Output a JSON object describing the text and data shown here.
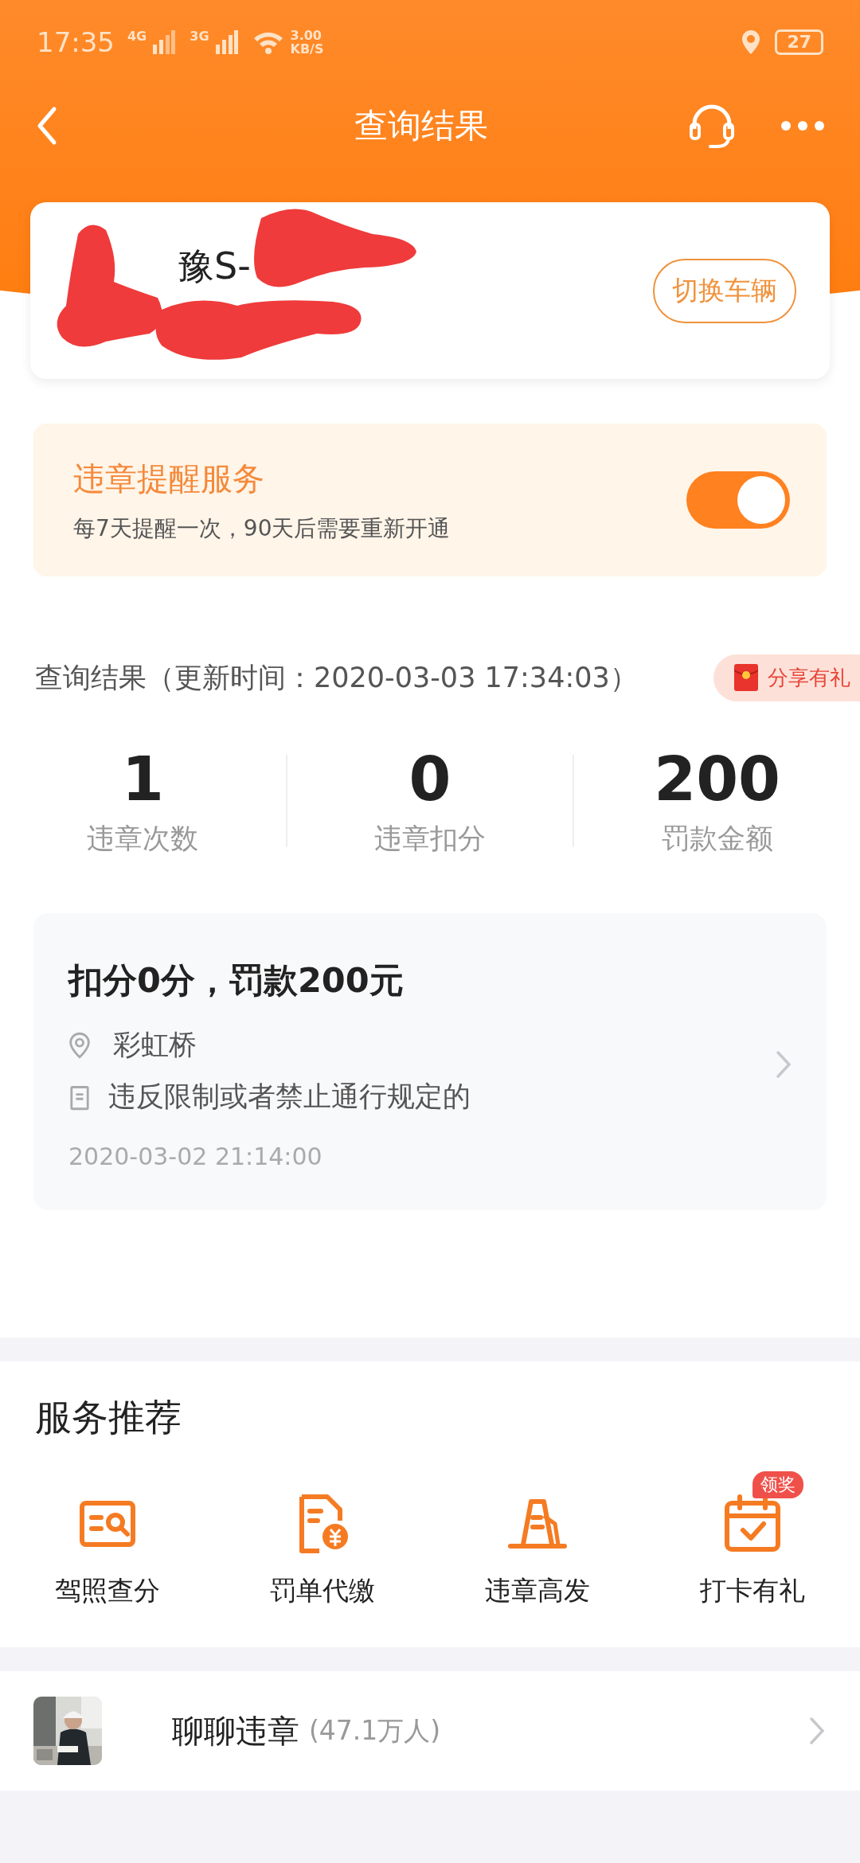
{
  "status_bar": {
    "time": "17:35",
    "net_1": "4G",
    "net_2": "3G",
    "speed": "3.00",
    "speed_unit": "KB/S",
    "battery": "27"
  },
  "header": {
    "title": "查询结果"
  },
  "vehicle": {
    "plate": "豫S-",
    "switch_button": "切换车辆"
  },
  "reminder": {
    "title": "违章提醒服务",
    "subtitle": "每7天提醒一次，90天后需要重新开通",
    "on": true
  },
  "result": {
    "heading": "查询结果（更新时间：2020-03-03 17:34:03）",
    "share_badge": "分享有礼"
  },
  "stats": [
    {
      "value": "1",
      "label": "违章次数"
    },
    {
      "value": "0",
      "label": "违章扣分"
    },
    {
      "value": "200",
      "label": "罚款金额"
    }
  ],
  "violations": [
    {
      "title": "扣分0分，罚款200元",
      "location": "彩虹桥",
      "reason": "违反限制或者禁止通行规定的",
      "time": "2020-03-02 21:14:00"
    }
  ],
  "services": {
    "title": "服务推荐",
    "items": [
      {
        "kind": "license",
        "label": "驾照查分"
      },
      {
        "kind": "fine",
        "label": "罚单代缴"
      },
      {
        "kind": "cone",
        "label": "违章高发"
      },
      {
        "kind": "checkin",
        "label": "打卡有礼",
        "badge": "领奖"
      }
    ]
  },
  "chat": {
    "title": "聊聊违章",
    "count": "(47.1万人)"
  }
}
